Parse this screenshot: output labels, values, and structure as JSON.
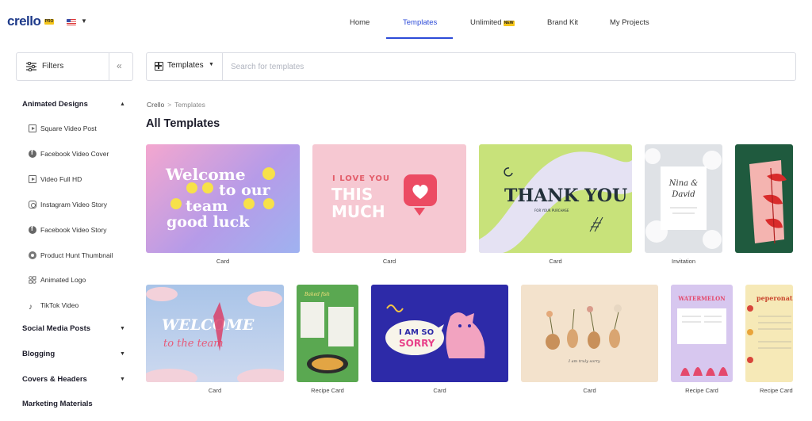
{
  "app": {
    "logo": "crello",
    "pro_badge": "PRO",
    "locale_icon": "us-flag-icon"
  },
  "nav": {
    "items": [
      {
        "label": "Home"
      },
      {
        "label": "Templates",
        "active": true
      },
      {
        "label": "Unlimited",
        "badge": "NEW"
      },
      {
        "label": "Brand Kit"
      },
      {
        "label": "My Projects"
      }
    ]
  },
  "sidebar": {
    "filters_label": "Filters",
    "sections": [
      {
        "label": "Animated Designs",
        "expanded": true,
        "items": [
          {
            "label": "Square Video Post",
            "icon": "play-square-icon"
          },
          {
            "label": "Facebook Video Cover",
            "icon": "facebook-icon"
          },
          {
            "label": "Video Full HD",
            "icon": "play-square-icon"
          },
          {
            "label": "Instagram Video Story",
            "icon": "instagram-icon"
          },
          {
            "label": "Facebook Video Story",
            "icon": "facebook-icon"
          },
          {
            "label": "Product Hunt Thumbnail",
            "icon": "producthunt-icon"
          },
          {
            "label": "Animated Logo",
            "icon": "shapes-icon"
          },
          {
            "label": "TikTok Video",
            "icon": "tiktok-icon"
          }
        ]
      },
      {
        "label": "Social Media Posts",
        "expanded": false
      },
      {
        "label": "Blogging",
        "expanded": false
      },
      {
        "label": "Covers & Headers",
        "expanded": false
      },
      {
        "label": "Marketing Materials",
        "expanded": false
      }
    ]
  },
  "search": {
    "dropdown_label": "Templates",
    "placeholder": "Search for templates",
    "value": ""
  },
  "breadcrumb": {
    "root": "Crello",
    "separator": ">",
    "current": "Templates"
  },
  "page_title": "All Templates",
  "cards_row1": [
    {
      "label": "Card",
      "art_text": [
        "Welcome",
        "to our",
        "team",
        "good luck"
      ],
      "bg": "#b69be8"
    },
    {
      "label": "Card",
      "art_text": [
        "I LOVE YOU",
        "THIS",
        "MUCH"
      ],
      "bg": "#f6c8d2"
    },
    {
      "label": "Card",
      "art_text": [
        "THANK YOU",
        "FOR YOUR PURCHASE"
      ],
      "bg": "#c8e27a"
    },
    {
      "label": "Invitation",
      "art_text": [
        "Nina &",
        "David"
      ],
      "bg": "#dfe2e6"
    },
    {
      "label": "",
      "art_text": [],
      "bg": "#1f5a3e"
    }
  ],
  "cards_row2": [
    {
      "label": "Card",
      "art_text": [
        "WELCOME",
        "to the team"
      ],
      "bg": "#b7cde8"
    },
    {
      "label": "Recipe Card",
      "art_text": [
        "Baked fish"
      ],
      "bg": "#5aa851"
    },
    {
      "label": "Card",
      "art_text": [
        "I AM SO",
        "SORRY"
      ],
      "bg": "#2d2aa8"
    },
    {
      "label": "Card",
      "art_text": [
        "I am truly sorry"
      ],
      "bg": "#f3e2cc"
    },
    {
      "label": "Recipe Card",
      "art_text": [
        "WATERMELON"
      ],
      "bg": "#d7c7ef"
    },
    {
      "label": "Recipe Card",
      "art_text": [
        "peperonata"
      ],
      "bg": "#f6e9b7"
    }
  ]
}
